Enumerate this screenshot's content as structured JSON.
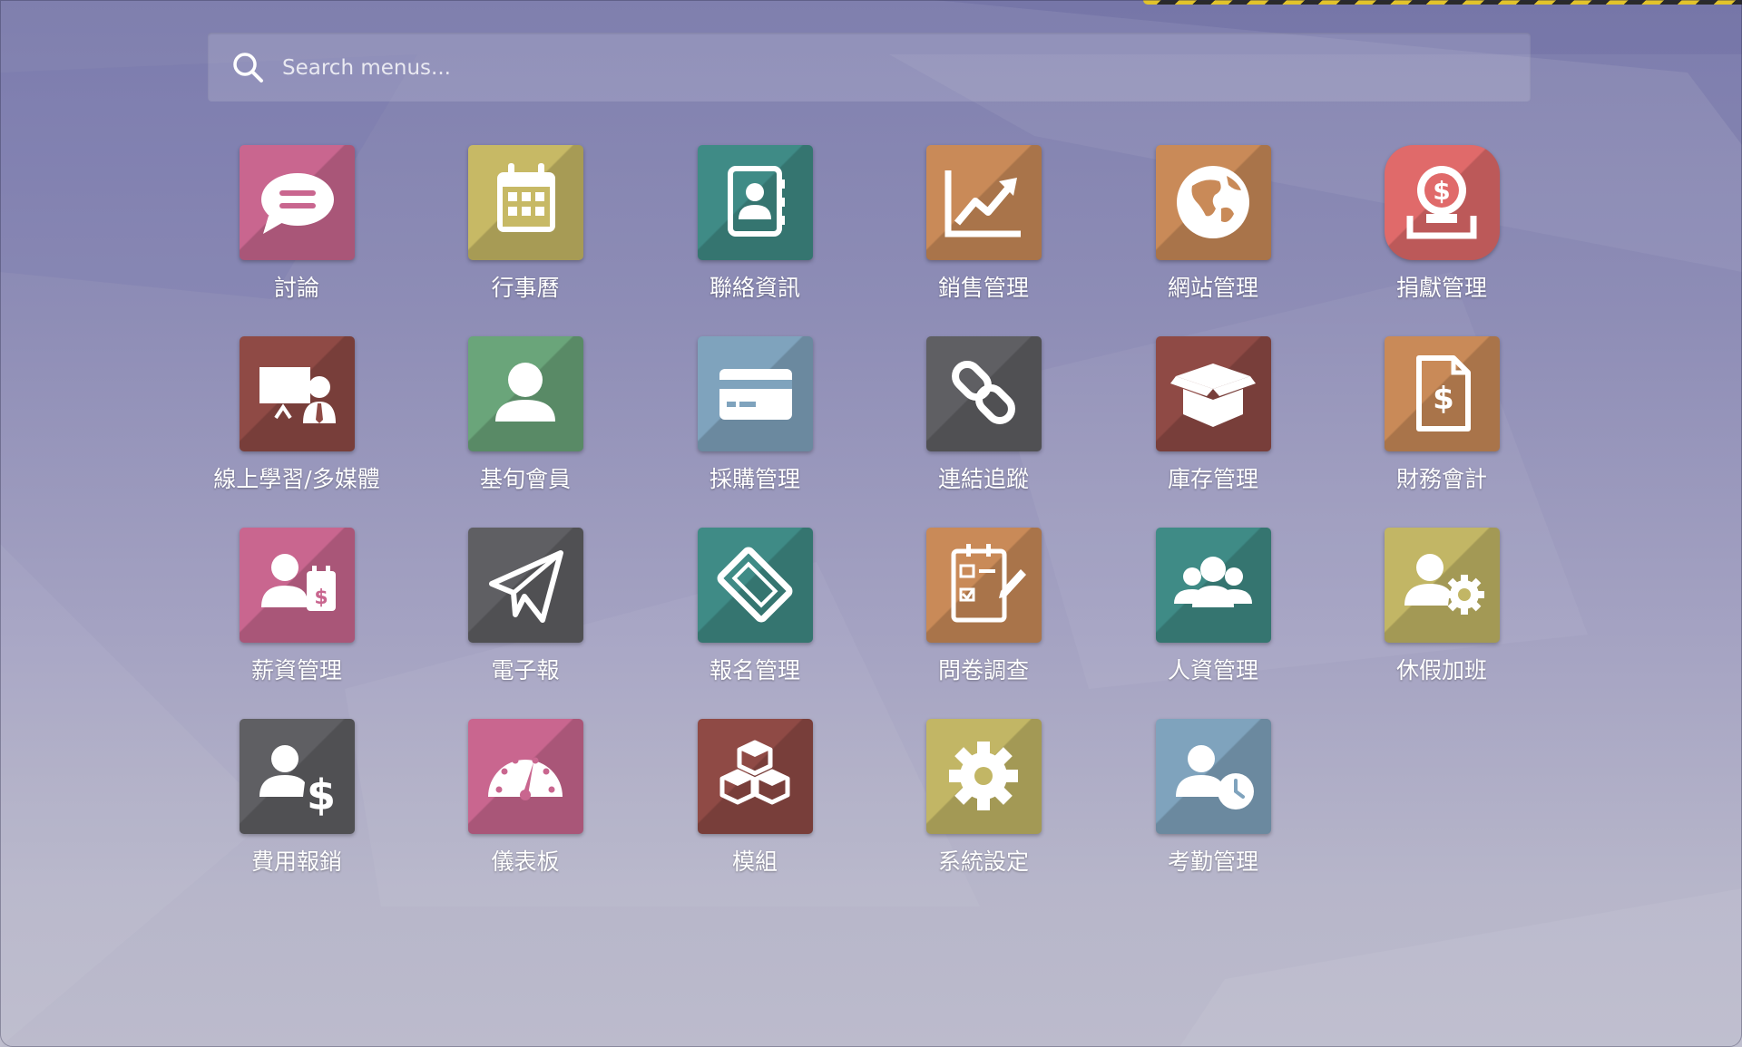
{
  "search": {
    "placeholder": "Search menus..."
  },
  "apps": [
    {
      "label": "討論",
      "icon": "chat-bubble-icon",
      "color": "#c9668f"
    },
    {
      "label": "行事曆",
      "icon": "calendar-icon",
      "color": "#c7b965"
    },
    {
      "label": "聯絡資訊",
      "icon": "contact-book-icon",
      "color": "#3f8b86"
    },
    {
      "label": "銷售管理",
      "icon": "trend-chart-icon",
      "color": "#c98a58"
    },
    {
      "label": "網站管理",
      "icon": "globe-icon",
      "color": "#c98a58"
    },
    {
      "label": "捐獻管理",
      "icon": "donation-coin-icon",
      "color": "#e06a6a"
    },
    {
      "label": "線上學習/多媒體",
      "icon": "presentation-icon",
      "color": "#8f4a45"
    },
    {
      "label": "基旬會員",
      "icon": "member-icon",
      "color": "#6aa57a"
    },
    {
      "label": "採購管理",
      "icon": "credit-card-icon",
      "color": "#7fa3bd"
    },
    {
      "label": "連結追蹤",
      "icon": "link-icon",
      "color": "#5f5f63"
    },
    {
      "label": "庫存管理",
      "icon": "box-icon",
      "color": "#8f4a45"
    },
    {
      "label": "財務會計",
      "icon": "invoice-icon",
      "color": "#c98a58"
    },
    {
      "label": "薪資管理",
      "icon": "payroll-icon",
      "color": "#c9668f"
    },
    {
      "label": "電子報",
      "icon": "paper-plane-icon",
      "color": "#5f5f63"
    },
    {
      "label": "報名管理",
      "icon": "ticket-icon",
      "color": "#3f8b86"
    },
    {
      "label": "問卷調查",
      "icon": "survey-icon",
      "color": "#c98a58"
    },
    {
      "label": "人資管理",
      "icon": "team-icon",
      "color": "#3f8b86"
    },
    {
      "label": "休假加班",
      "icon": "user-gear-icon",
      "color": "#c2b665"
    },
    {
      "label": "費用報銷",
      "icon": "expense-icon",
      "color": "#5f5f63"
    },
    {
      "label": "儀表板",
      "icon": "dashboard-gauge-icon",
      "color": "#c9668f"
    },
    {
      "label": "模組",
      "icon": "cubes-icon",
      "color": "#8f4a45"
    },
    {
      "label": "系統設定",
      "icon": "gear-icon",
      "color": "#c2b665"
    },
    {
      "label": "考勤管理",
      "icon": "user-clock-icon",
      "color": "#7fa3bd"
    }
  ]
}
